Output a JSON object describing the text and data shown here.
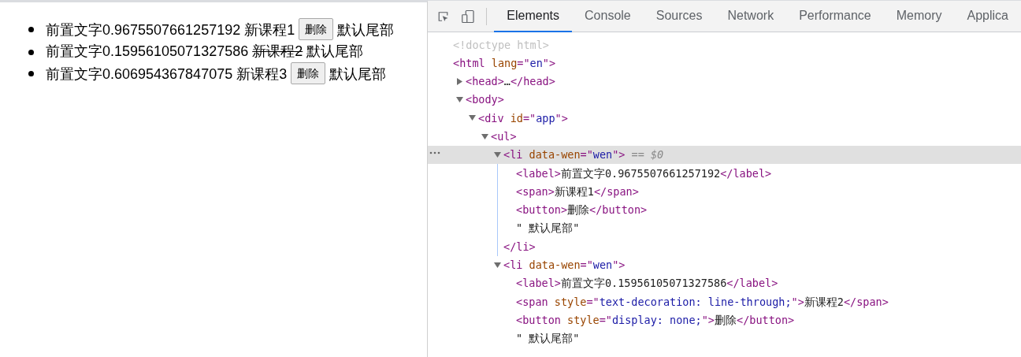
{
  "page": {
    "items": [
      {
        "label": "前置文字0.9675507661257192",
        "course": "新课程1",
        "done": false,
        "button": "删除",
        "suffix": "默认尾部"
      },
      {
        "label": "前置文字0.15956105071327586",
        "course": "新课程2",
        "done": true,
        "suffix": "默认尾部"
      },
      {
        "label": "前置文字0.606954367847075",
        "course": "新课程3",
        "done": false,
        "button": "删除",
        "suffix": "默认尾部"
      }
    ]
  },
  "devtools": {
    "tabs": [
      {
        "label": "Elements",
        "selected": true
      },
      {
        "label": "Console",
        "selected": false
      },
      {
        "label": "Sources",
        "selected": false
      },
      {
        "label": "Network",
        "selected": false
      },
      {
        "label": "Performance",
        "selected": false
      },
      {
        "label": "Memory",
        "selected": false
      },
      {
        "label": "Applica",
        "selected": false
      }
    ],
    "tree": [
      {
        "parts": [
          {
            "kind": "doctype",
            "text": "<!doctype html>"
          }
        ],
        "selected": false
      },
      {
        "parts": [
          {
            "kind": "tag",
            "text": "<html "
          },
          {
            "kind": "attr",
            "text": "lang"
          },
          {
            "kind": "tag",
            "text": "=\""
          },
          {
            "kind": "value",
            "text": "en"
          },
          {
            "kind": "tag",
            "text": "\">"
          }
        ],
        "selected": false,
        "children": [
          {
            "parts": [
              {
                "kind": "tag",
                "text": "<head>"
              },
              {
                "kind": "text",
                "text": "…"
              },
              {
                "kind": "tag",
                "text": "</head>"
              }
            ],
            "expanded": false,
            "selected": false
          },
          {
            "parts": [
              {
                "kind": "tag",
                "text": "<body>"
              }
            ],
            "expanded": true,
            "selected": false,
            "children": [
              {
                "parts": [
                  {
                    "kind": "tag",
                    "text": "<div "
                  },
                  {
                    "kind": "attr",
                    "text": "id"
                  },
                  {
                    "kind": "tag",
                    "text": "=\""
                  },
                  {
                    "kind": "value",
                    "text": "app"
                  },
                  {
                    "kind": "tag",
                    "text": "\">"
                  }
                ],
                "expanded": true,
                "selected": false,
                "children": [
                  {
                    "parts": [
                      {
                        "kind": "tag",
                        "text": "<ul>"
                      }
                    ],
                    "expanded": true,
                    "selected": false,
                    "children": [
                      {
                        "parts": [
                          {
                            "kind": "tag",
                            "text": "<li "
                          },
                          {
                            "kind": "attr",
                            "text": "data-wen"
                          },
                          {
                            "kind": "tag",
                            "text": "=\""
                          },
                          {
                            "kind": "value",
                            "text": "wen"
                          },
                          {
                            "kind": "tag",
                            "text": "\">"
                          },
                          {
                            "kind": "note",
                            "text": " == $0"
                          }
                        ],
                        "expanded": true,
                        "selected": true,
                        "close": [
                          {
                            "kind": "tag",
                            "text": "</li>"
                          }
                        ],
                        "children": [
                          {
                            "parts": [
                              {
                                "kind": "tag",
                                "text": "<label>"
                              },
                              {
                                "kind": "text",
                                "text": "前置文字0.9675507661257192"
                              },
                              {
                                "kind": "tag",
                                "text": "</label>"
                              }
                            ],
                            "selected": false
                          },
                          {
                            "parts": [
                              {
                                "kind": "tag",
                                "text": "<span>"
                              },
                              {
                                "kind": "text",
                                "text": "新课程1"
                              },
                              {
                                "kind": "tag",
                                "text": "</span>"
                              }
                            ],
                            "selected": false
                          },
                          {
                            "parts": [
                              {
                                "kind": "tag",
                                "text": "<button>"
                              },
                              {
                                "kind": "text",
                                "text": "删除"
                              },
                              {
                                "kind": "tag",
                                "text": "</button>"
                              }
                            ],
                            "selected": false
                          },
                          {
                            "parts": [
                              {
                                "kind": "text",
                                "text": "\" 默认尾部\""
                              }
                            ],
                            "selected": false
                          }
                        ]
                      },
                      {
                        "parts": [
                          {
                            "kind": "tag",
                            "text": "<li "
                          },
                          {
                            "kind": "attr",
                            "text": "data-wen"
                          },
                          {
                            "kind": "tag",
                            "text": "=\""
                          },
                          {
                            "kind": "value",
                            "text": "wen"
                          },
                          {
                            "kind": "tag",
                            "text": "\">"
                          }
                        ],
                        "expanded": true,
                        "selected": false,
                        "children": [
                          {
                            "parts": [
                              {
                                "kind": "tag",
                                "text": "<label>"
                              },
                              {
                                "kind": "text",
                                "text": "前置文字0.15956105071327586"
                              },
                              {
                                "kind": "tag",
                                "text": "</label>"
                              }
                            ],
                            "selected": false
                          },
                          {
                            "parts": [
                              {
                                "kind": "tag",
                                "text": "<span "
                              },
                              {
                                "kind": "attr",
                                "text": "style"
                              },
                              {
                                "kind": "tag",
                                "text": "=\""
                              },
                              {
                                "kind": "value",
                                "text": "text-decoration: line-through;"
                              },
                              {
                                "kind": "tag",
                                "text": "\">"
                              },
                              {
                                "kind": "text",
                                "text": "新课程2"
                              },
                              {
                                "kind": "tag",
                                "text": "</span>"
                              }
                            ],
                            "selected": false
                          },
                          {
                            "parts": [
                              {
                                "kind": "tag",
                                "text": "<button "
                              },
                              {
                                "kind": "attr",
                                "text": "style"
                              },
                              {
                                "kind": "tag",
                                "text": "=\""
                              },
                              {
                                "kind": "value",
                                "text": "display: none;"
                              },
                              {
                                "kind": "tag",
                                "text": "\">"
                              },
                              {
                                "kind": "text",
                                "text": "删除"
                              },
                              {
                                "kind": "tag",
                                "text": "</button>"
                              }
                            ],
                            "selected": false
                          },
                          {
                            "parts": [
                              {
                                "kind": "text",
                                "text": "\" 默认尾部\""
                              }
                            ],
                            "selected": false
                          }
                        ]
                      }
                    ]
                  }
                ]
              }
            ]
          }
        ]
      }
    ]
  }
}
